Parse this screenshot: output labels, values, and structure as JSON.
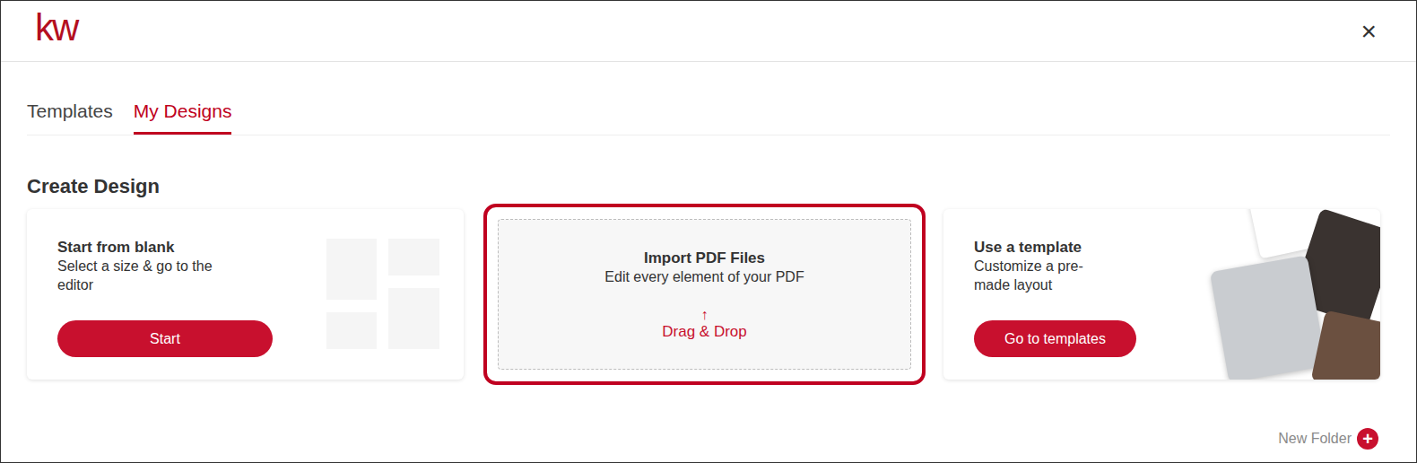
{
  "window": {
    "logo": "kw",
    "close": "×"
  },
  "tabs": [
    {
      "label": "Templates",
      "selected": false
    },
    {
      "label": "My Designs",
      "selected": true
    }
  ],
  "heading": "Create Design",
  "cards": [
    {
      "kind": "blank",
      "title": "Start from blank",
      "subtitle": "Select a size & go to the editor",
      "button": "Start",
      "highlighted": false
    },
    {
      "kind": "import",
      "title": "Import PDF Files",
      "subtitle": "Edit every element of your PDF",
      "arrow": "↑",
      "action": "Drag & Drop",
      "highlighted": true
    },
    {
      "kind": "template",
      "title": "Use a template",
      "subtitle": "Customize a pre-made layout",
      "button": "Go to templates",
      "highlighted": false
    }
  ],
  "new_folder": {
    "label": "New Folder",
    "icon": "+"
  }
}
